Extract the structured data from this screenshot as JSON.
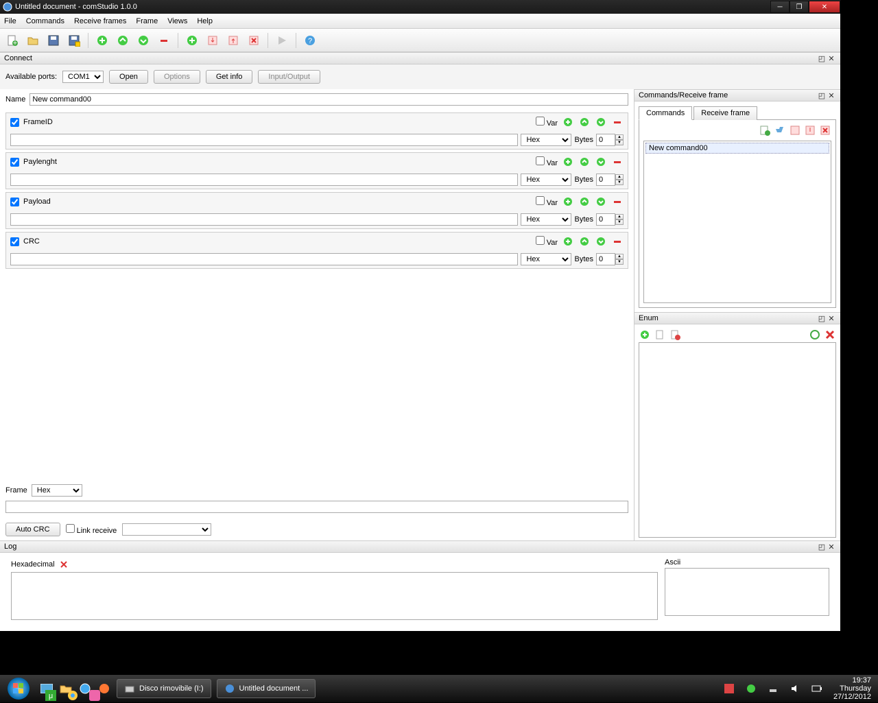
{
  "window_title": "Untitled document - comStudio 1.0.0",
  "menu": [
    "File",
    "Commands",
    "Receive frames",
    "Frame",
    "Views",
    "Help"
  ],
  "panels": {
    "connect": "Connect",
    "commands_frame": "Commands/Receive frame",
    "enum": "Enum",
    "log": "Log"
  },
  "connect": {
    "label": "Available ports:",
    "port": "COM1",
    "open": "Open",
    "options": "Options",
    "getinfo": "Get info",
    "inout": "Input/Output"
  },
  "name_label": "Name",
  "name_value": "New command00",
  "fields": [
    {
      "label": "FrameID",
      "checked": true,
      "var": "Var",
      "fmt": "Hex",
      "bytes_label": "Bytes",
      "bytes": "0"
    },
    {
      "label": "Paylenght",
      "checked": true,
      "var": "Var",
      "fmt": "Hex",
      "bytes_label": "Bytes",
      "bytes": "0"
    },
    {
      "label": "Payload",
      "checked": true,
      "var": "Var",
      "fmt": "Hex",
      "bytes_label": "Bytes",
      "bytes": "0"
    },
    {
      "label": "CRC",
      "checked": true,
      "var": "Var",
      "fmt": "Hex",
      "bytes_label": "Bytes",
      "bytes": "0"
    }
  ],
  "frame_label": "Frame",
  "frame_fmt": "Hex",
  "autocrc": "Auto CRC",
  "linkreceive": "Link receive",
  "tabs": {
    "commands": "Commands",
    "receive": "Receive frame"
  },
  "cmd_list": [
    "New command00"
  ],
  "log": {
    "hex": "Hexadecimal",
    "ascii": "Ascii"
  },
  "taskbar": {
    "task1": "Disco rimovibile (I:)",
    "task2": "Untitled document ...",
    "time": "19:37",
    "day": "Thursday",
    "date": "27/12/2012"
  }
}
